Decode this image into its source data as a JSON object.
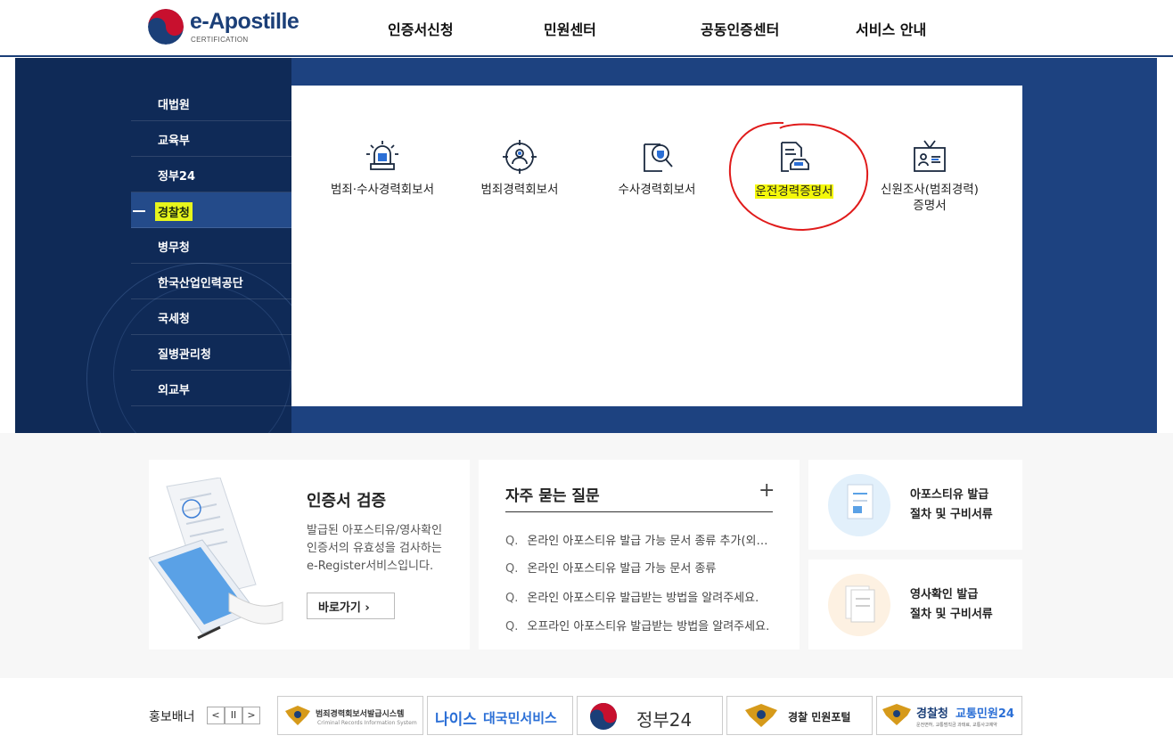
{
  "header": {
    "logo_title": "e-Apostille",
    "logo_sub": "CERTIFICATION",
    "nav": [
      "인증서신청",
      "민원센터",
      "공동인증센터",
      "서비스 안내"
    ]
  },
  "sidebar": {
    "items": [
      {
        "label": "대법원"
      },
      {
        "label": "교육부"
      },
      {
        "label": "정부24"
      },
      {
        "label": "경찰청"
      },
      {
        "label": "병무청"
      },
      {
        "label": "한국산업인력공단"
      },
      {
        "label": "국세청"
      },
      {
        "label": "질병관리청"
      },
      {
        "label": "외교부"
      }
    ],
    "active_index": 3
  },
  "certificates": [
    {
      "line1": "범죄·수사경력회보서",
      "line2": ""
    },
    {
      "line1": "범죄경력회보서",
      "line2": ""
    },
    {
      "line1": "수사경력회보서",
      "line2": ""
    },
    {
      "line1": "운전경력증명서",
      "line2": ""
    },
    {
      "line1": "신원조사(범죄경력)",
      "line2": "증명서"
    }
  ],
  "verify": {
    "title": "인증서 검증",
    "desc1": "발급된 아포스티유/영사확인",
    "desc2": "인증서의 유효성을 검사하는",
    "desc3": "e-Register서비스입니다.",
    "button": "바로가기"
  },
  "faq": {
    "title": "자주 묻는 질문",
    "q_marker": "Q.",
    "items": [
      "온라인 아포스티유 발급 가능 문서 종류 추가(외…",
      "온라인 아포스티유 발급 가능 문서 종류",
      "온라인 아포스티유 발급받는 방법을 알려주세요.",
      "오프라인 아포스티유 발급받는 방법을 알려주세요."
    ]
  },
  "guides": [
    {
      "line1": "아포스티유 발급",
      "line2": "절차 및 구비서류"
    },
    {
      "line1": "영사확인 발급",
      "line2": "절차 및 구비서류"
    }
  ],
  "promo": {
    "label": "홍보배너",
    "controls": [
      "<",
      "II",
      ">"
    ],
    "banners": {
      "b1_title": "범죄경력회보서발급시스템",
      "b1_sub": "Criminal Records Information System",
      "b2_a": "나이스",
      "b2_b": "대국민서비스",
      "b3": "정부24",
      "b4": "경찰 민원포털",
      "b5_a": "경찰청",
      "b5_b": "교통민원24",
      "b5_sub": "운전면허, 교통범칙금 과태료, 교통사고예약"
    }
  },
  "colors": {
    "navy": "#1b3f78",
    "band": "#1d4280",
    "band_left": "#0f2a57",
    "highlight": "#f4f80a",
    "annotation_red": "#e01b1b"
  }
}
